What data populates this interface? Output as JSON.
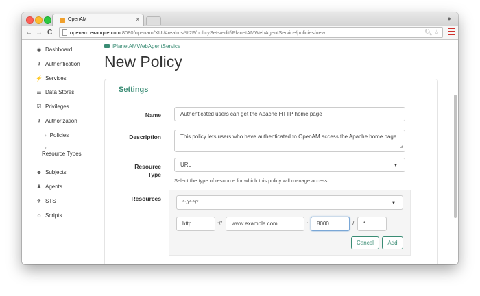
{
  "browser": {
    "tab_title": "OpenAM",
    "tab_close": "×",
    "url_host": "openam.example.com",
    "url_rest": ":8080/openam/XUI/#realms/%2F/policySets/edit/iPlanetAMWebAgentService/policies/new",
    "nav_back": "←",
    "nav_forward": "→",
    "nav_reload": "C",
    "url_icons": "🔍︎ ☆"
  },
  "sidebar": {
    "items": [
      {
        "label": "Dashboard",
        "icon": "dashboard-icon",
        "glyph": "◉"
      },
      {
        "label": "Authentication",
        "icon": "key-icon",
        "glyph": "⚷"
      },
      {
        "label": "Services",
        "icon": "plug-icon",
        "glyph": "⚡"
      },
      {
        "label": "Data Stores",
        "icon": "database-icon",
        "glyph": "☰"
      },
      {
        "label": "Privileges",
        "icon": "check-icon",
        "glyph": "☑"
      },
      {
        "label": "Authorization",
        "icon": "key-icon",
        "glyph": "⚷"
      },
      {
        "label": "Subjects",
        "icon": "users-icon",
        "glyph": "☻"
      },
      {
        "label": "Agents",
        "icon": "agent-icon",
        "glyph": "♟"
      },
      {
        "label": "STS",
        "icon": "plane-icon",
        "glyph": "✈"
      },
      {
        "label": "Scripts",
        "icon": "code-icon",
        "glyph": "‹›"
      }
    ],
    "sub_items": [
      {
        "label": "Policies",
        "chevron": "›"
      },
      {
        "label": "Resource Types",
        "chevron": "›"
      }
    ]
  },
  "breadcrumb": "iPlanetAMWebAgentService",
  "page_title": "New Policy",
  "settings": {
    "title": "Settings",
    "name_label": "Name",
    "name_value": "Authenticated users can get the Apache HTTP home page",
    "description_label": "Description",
    "description_value": "This policy lets users who have authenticated to OpenAM access the Apache home page",
    "resource_type_label_1": "Resource",
    "resource_type_label_2": "Type",
    "resource_type_value": "URL",
    "resource_type_help": "Select the type of resource for which this policy will manage access.",
    "resources_label": "Resources",
    "resource_pattern": "*://*:*/*",
    "scheme": "http",
    "scheme_sep": "://",
    "host": "www.example.com",
    "port_sep": ":",
    "port": "8000",
    "path_sep": "/",
    "path": "*",
    "cancel_label": "Cancel",
    "add_label": "Add",
    "caret": "▼"
  },
  "colors": {
    "accent": "#3a8c74",
    "menu": "#d0312d"
  }
}
